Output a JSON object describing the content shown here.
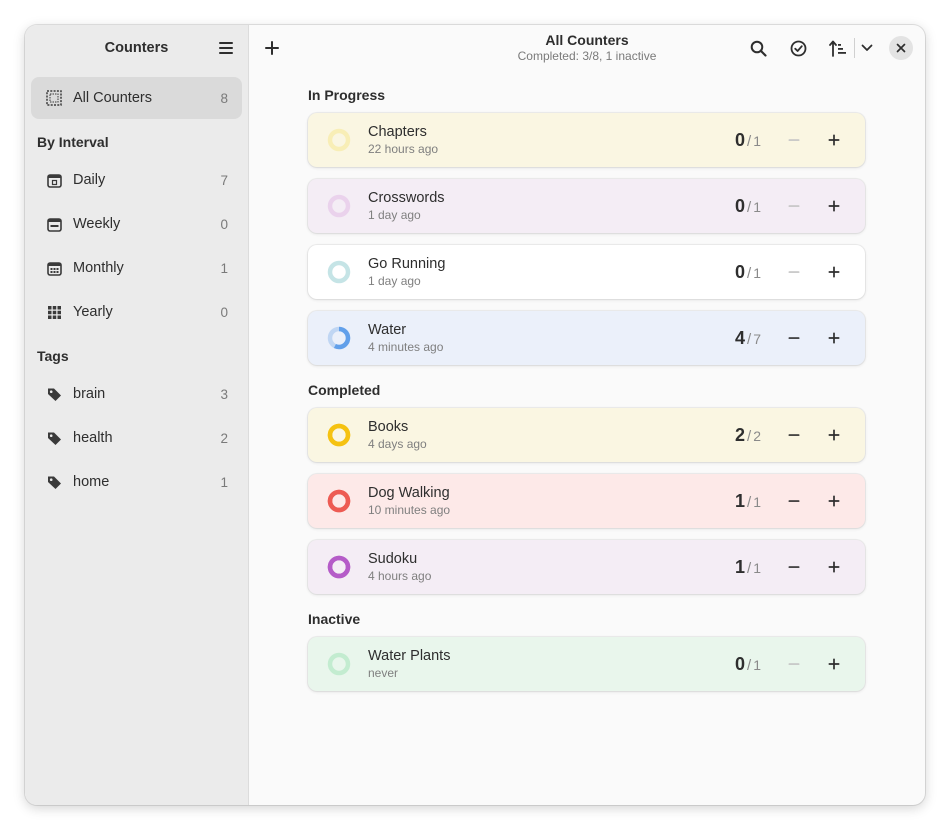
{
  "sidebar": {
    "title": "Counters",
    "all": {
      "label": "All Counters",
      "count": "8"
    },
    "interval_title": "By Interval",
    "intervals": [
      {
        "label": "Daily",
        "count": "7",
        "icon": "calendar-day-icon"
      },
      {
        "label": "Weekly",
        "count": "0",
        "icon": "calendar-week-icon"
      },
      {
        "label": "Monthly",
        "count": "1",
        "icon": "calendar-month-icon"
      },
      {
        "label": "Yearly",
        "count": "0",
        "icon": "calendar-year-icon"
      }
    ],
    "tags_title": "Tags",
    "tags": [
      {
        "label": "brain",
        "count": "3"
      },
      {
        "label": "health",
        "count": "2"
      },
      {
        "label": "home",
        "count": "1"
      }
    ]
  },
  "header": {
    "title": "All Counters",
    "subtitle": "Completed: 3/8, 1 inactive"
  },
  "sections": [
    {
      "title": "In Progress",
      "cards": [
        {
          "name": "Chapters",
          "time": "22 hours ago",
          "value": 0,
          "total": 1,
          "bg": "#faf6e2",
          "color": "#f6e27a",
          "track": "#f8eeb6",
          "minus_enabled": false
        },
        {
          "name": "Crosswords",
          "time": "1 day ago",
          "value": 0,
          "total": 1,
          "bg": "#f4edf5",
          "color": "#e2bce5",
          "track": "#ead2ec",
          "minus_enabled": false
        },
        {
          "name": "Go Running",
          "time": "1 day ago",
          "value": 0,
          "total": 1,
          "bg": "#ffffff",
          "color": "#a6d9dd",
          "track": "#c5e4e6",
          "minus_enabled": false
        },
        {
          "name": "Water",
          "time": "4 minutes ago",
          "value": 4,
          "total": 7,
          "bg": "#ebf0fa",
          "color": "#62a0ea",
          "track": "#c0d6f3",
          "minus_enabled": true
        }
      ]
    },
    {
      "title": "Completed",
      "cards": [
        {
          "name": "Books",
          "time": "4 days ago",
          "value": 2,
          "total": 2,
          "bg": "#faf6e2",
          "color": "#f5c211",
          "track": "#f5c211",
          "minus_enabled": true
        },
        {
          "name": "Dog Walking",
          "time": "10 minutes ago",
          "value": 1,
          "total": 1,
          "bg": "#fde9e8",
          "color": "#ed5b53",
          "track": "#ed5b53",
          "minus_enabled": true
        },
        {
          "name": "Sudoku",
          "time": "4 hours ago",
          "value": 1,
          "total": 1,
          "bg": "#f4edf5",
          "color": "#b55cc8",
          "track": "#b55cc8",
          "minus_enabled": true
        }
      ]
    },
    {
      "title": "Inactive",
      "cards": [
        {
          "name": "Water Plants",
          "time": "never",
          "value": 0,
          "total": 1,
          "bg": "#e9f6ec",
          "color": "#a7e3bc",
          "track": "#c3ecd0",
          "minus_enabled": false
        }
      ]
    }
  ],
  "slash": "/"
}
